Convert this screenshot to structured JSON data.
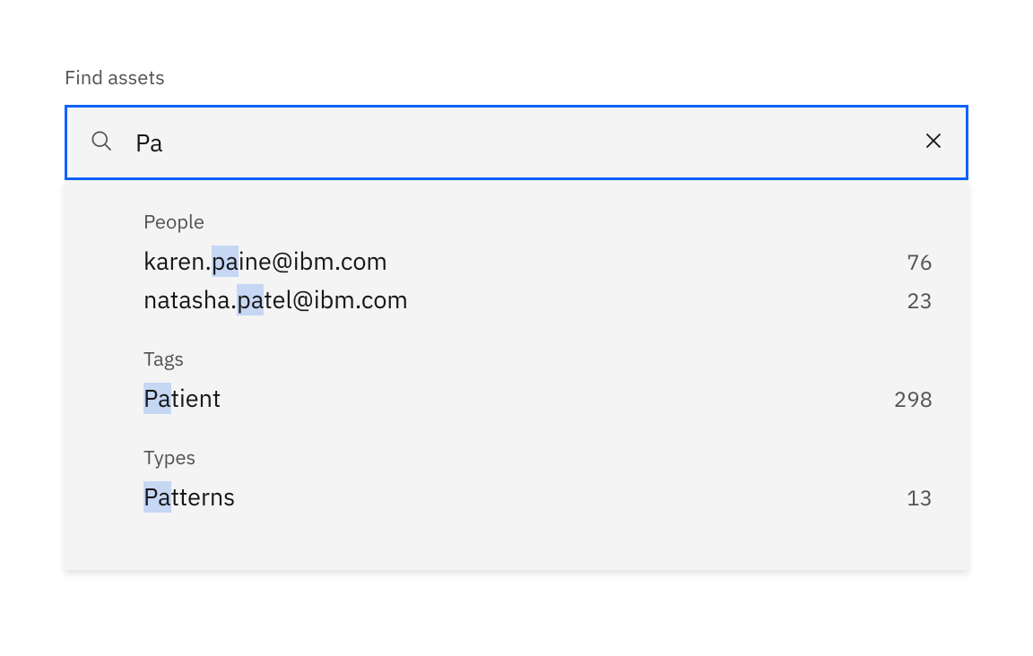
{
  "label": "Find assets",
  "search_value": "Pa",
  "groups": [
    {
      "heading": "People",
      "items": [
        {
          "pre": "karen.",
          "match": "pa",
          "post": "ine@ibm.com",
          "count": "76"
        },
        {
          "pre": "natasha.",
          "match": "pa",
          "post": "tel@ibm.com",
          "count": "23"
        }
      ]
    },
    {
      "heading": "Tags",
      "items": [
        {
          "pre": "",
          "match": "Pa",
          "post": "tient",
          "count": "298"
        }
      ]
    },
    {
      "heading": "Types",
      "items": [
        {
          "pre": "",
          "match": "Pa",
          "post": "tterns",
          "count": "13"
        }
      ]
    }
  ]
}
